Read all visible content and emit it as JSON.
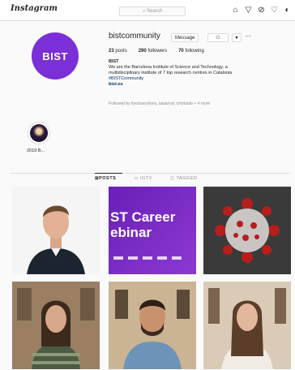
{
  "nav": {
    "logo": "Instagram",
    "search_placeholder": "Search",
    "icons": [
      "home-icon",
      "filter-icon",
      "explore-icon",
      "heart-icon",
      "profile-icon"
    ]
  },
  "profile": {
    "avatar_text": "BIST",
    "avatar_color": "#7b2fd6",
    "username": "bistcommunity",
    "message_label": "Message",
    "follow_label": "",
    "stats": {
      "posts": "23",
      "posts_label": "posts",
      "followers": "290",
      "followers_label": "followers",
      "following": "70",
      "following_label": "following"
    },
    "bio": {
      "name": "BIST",
      "line1": "We are the Barcelona Institute of Science and Technology, a",
      "line2": "multidisciplinary institute of 7 top research centres in Catalonia",
      "hashtag": "#BISTCommunity",
      "link": "bist.eu"
    },
    "followed_by": "Followed by ibecbarcelona, iaiaarnal, icforkada + 4 more"
  },
  "highlights": [
    {
      "label": "2019 B..."
    }
  ],
  "tabs": [
    {
      "label": "POSTS",
      "active": true
    },
    {
      "label": "IGTV",
      "active": false
    },
    {
      "label": "TAGGED",
      "active": false
    }
  ],
  "posts": {
    "career_line1": "ST Career",
    "career_line2": "ebinar"
  }
}
